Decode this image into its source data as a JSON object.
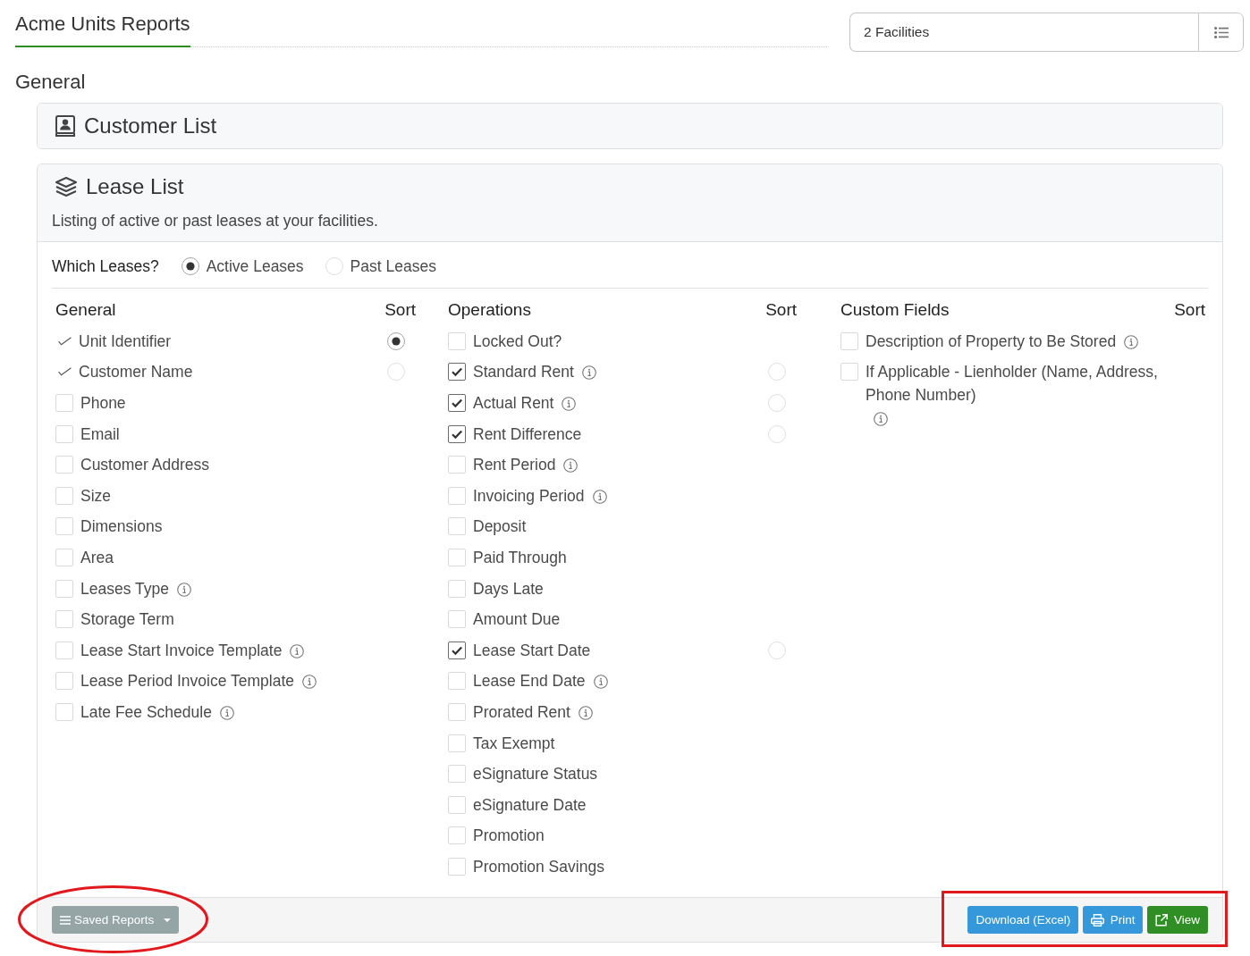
{
  "header": {
    "title": "Acme Units Reports",
    "facilities": {
      "value": "2 Facilities"
    }
  },
  "section_title": "General",
  "reports": [
    {
      "title": "Customer List",
      "expanded": false
    },
    {
      "title": "Lease List",
      "expanded": true,
      "description": "Listing of active or past leases at your facilities.",
      "which_leases": {
        "label": "Which Leases?",
        "options": [
          {
            "label": "Active Leases",
            "selected": true
          },
          {
            "label": "Past Leases",
            "selected": false
          }
        ]
      },
      "columns": [
        {
          "heading": "General",
          "sort_label": "Sort",
          "fields": [
            {
              "label": "Unit Identifier",
              "kind": "required",
              "sort_selected": true
            },
            {
              "label": "Customer Name",
              "kind": "required",
              "sort_selected": false
            },
            {
              "label": "Phone",
              "kind": "checkbox",
              "checked": false
            },
            {
              "label": "Email",
              "kind": "checkbox",
              "checked": false
            },
            {
              "label": "Customer Address",
              "kind": "checkbox",
              "checked": false
            },
            {
              "label": "Size",
              "kind": "checkbox",
              "checked": false
            },
            {
              "label": "Dimensions",
              "kind": "checkbox",
              "checked": false
            },
            {
              "label": "Area",
              "kind": "checkbox",
              "checked": false
            },
            {
              "label": "Leases Type",
              "kind": "checkbox",
              "checked": false,
              "info": true
            },
            {
              "label": "Storage Term",
              "kind": "checkbox",
              "checked": false
            },
            {
              "label": "Lease Start Invoice Template",
              "kind": "checkbox",
              "checked": false,
              "info": true
            },
            {
              "label": "Lease Period Invoice Template",
              "kind": "checkbox",
              "checked": false,
              "info": true
            },
            {
              "label": "Late Fee Schedule",
              "kind": "checkbox",
              "checked": false,
              "info": true
            }
          ]
        },
        {
          "heading": "Operations",
          "sort_label": "Sort",
          "fields": [
            {
              "label": "Locked Out?",
              "kind": "checkbox",
              "checked": false
            },
            {
              "label": "Standard Rent",
              "kind": "checkbox",
              "checked": true,
              "info": true,
              "sort_selected": false
            },
            {
              "label": "Actual Rent",
              "kind": "checkbox",
              "checked": true,
              "info": true,
              "sort_selected": false
            },
            {
              "label": "Rent Difference",
              "kind": "checkbox",
              "checked": true,
              "sort_selected": false
            },
            {
              "label": "Rent Period",
              "kind": "checkbox",
              "checked": false,
              "info": true
            },
            {
              "label": "Invoicing Period",
              "kind": "checkbox",
              "checked": false,
              "info": true
            },
            {
              "label": "Deposit",
              "kind": "checkbox",
              "checked": false
            },
            {
              "label": "Paid Through",
              "kind": "checkbox",
              "checked": false
            },
            {
              "label": "Days Late",
              "kind": "checkbox",
              "checked": false
            },
            {
              "label": "Amount Due",
              "kind": "checkbox",
              "checked": false
            },
            {
              "label": "Lease Start Date",
              "kind": "checkbox",
              "checked": true,
              "sort_selected": false
            },
            {
              "label": "Lease End Date",
              "kind": "checkbox",
              "checked": false,
              "info": true
            },
            {
              "label": "Prorated Rent",
              "kind": "checkbox",
              "checked": false,
              "info": true
            },
            {
              "label": "Tax Exempt",
              "kind": "checkbox",
              "checked": false
            },
            {
              "label": "eSignature Status",
              "kind": "checkbox",
              "checked": false
            },
            {
              "label": "eSignature Date",
              "kind": "checkbox",
              "checked": false
            },
            {
              "label": "Promotion",
              "kind": "checkbox",
              "checked": false
            },
            {
              "label": "Promotion Savings",
              "kind": "checkbox",
              "checked": false
            }
          ]
        },
        {
          "heading": "Custom Fields",
          "sort_label": "Sort",
          "fields": [
            {
              "label": "Description of Property to Be Stored",
              "kind": "checkbox",
              "checked": false,
              "info": true
            },
            {
              "label": "If Applicable - Lienholder (Name, Address, Phone Number)",
              "kind": "checkbox",
              "checked": false,
              "info": true
            }
          ]
        }
      ],
      "footer": {
        "saved_reports": {
          "label": "Saved Reports",
          "highlighted": true
        },
        "actions": {
          "highlighted": true,
          "buttons": [
            {
              "label": "Download (Excel)",
              "kind": "download"
            },
            {
              "label": "Print",
              "kind": "print"
            },
            {
              "label": "View",
              "kind": "view"
            }
          ]
        }
      }
    }
  ]
}
